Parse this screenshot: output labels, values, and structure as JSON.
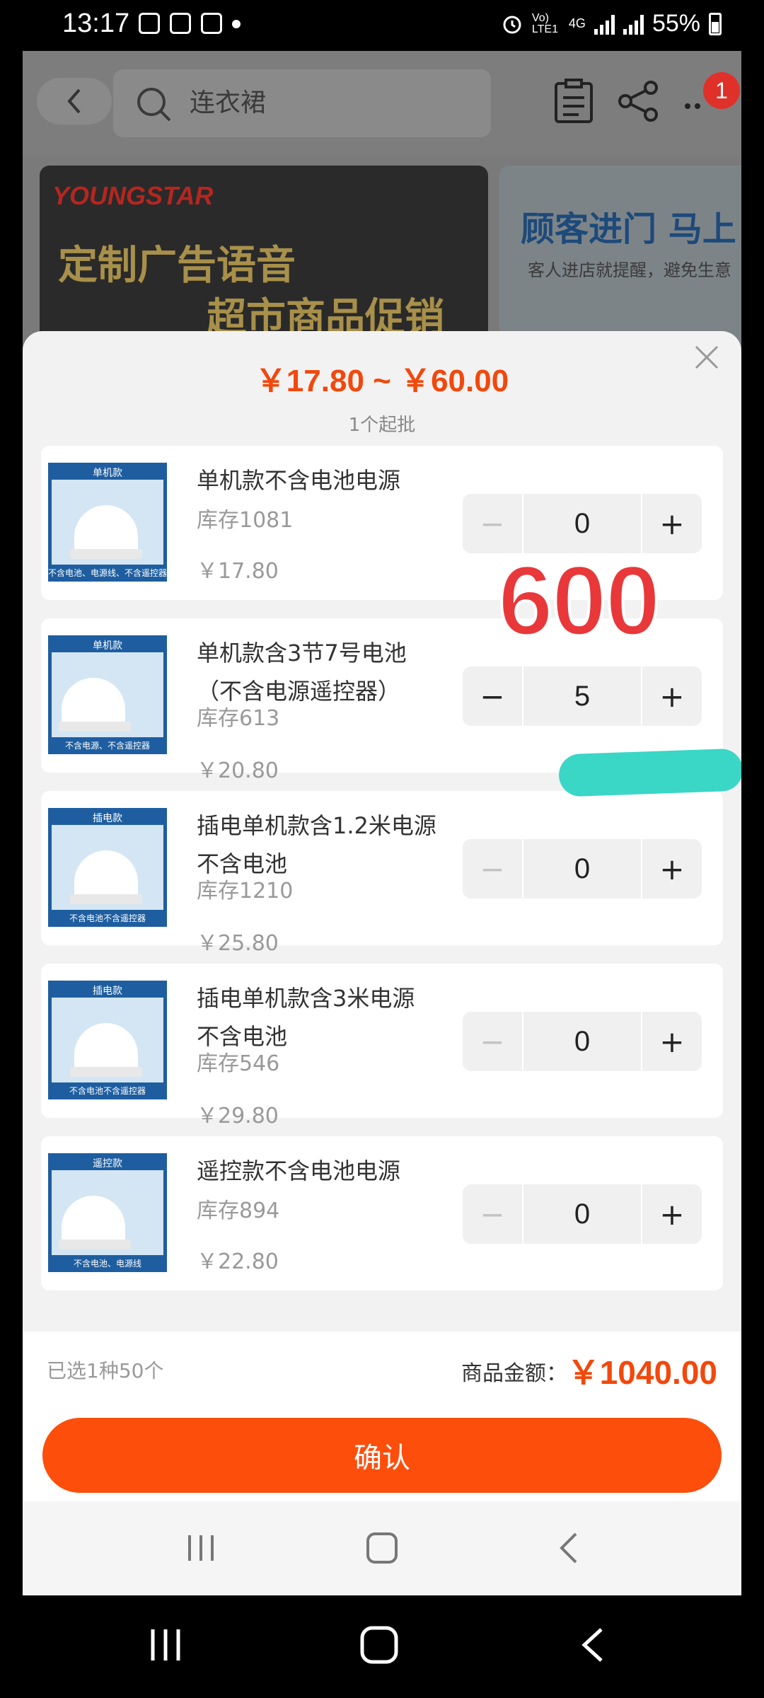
{
  "status_bar": {
    "time": "13:17",
    "battery": "55%",
    "net_label": "4G",
    "volte_label": "Vo) LTE1"
  },
  "header": {
    "search_placeholder": "连衣裙",
    "cart_badge": "1"
  },
  "banners": {
    "left": {
      "logo": "YOUNGSTAR",
      "line1": "定制广告语音",
      "line2": "超市商品促销"
    },
    "right": {
      "title": "顾客进门 马上",
      "subtitle": "客人进店就提醒，避免生意"
    }
  },
  "sheet": {
    "price_range": "￥17.80 ~ ￥60.00",
    "moq": "1个起批",
    "overlay_number": "600",
    "products": [
      {
        "tag": "单机款",
        "caption": "不含电池、电源线、不含遥控器",
        "name": "单机款不含电池电源",
        "stock": "库存1081",
        "price": "￥17.80",
        "qty": "0",
        "minus": "−",
        "plus": "+"
      },
      {
        "tag": "单机款",
        "caption": "不含电源、不含遥控器",
        "name": "单机款含3节7号电池（不含电源遥控器）",
        "stock": "库存613",
        "price": "￥20.80",
        "qty": "5",
        "minus": "−",
        "plus": "+"
      },
      {
        "tag": "插电款",
        "caption": "不含电池不含遥控器",
        "name": "插电单机款含1.2米电源不含电池",
        "stock": "库存1210",
        "price": "￥25.80",
        "qty": "0",
        "minus": "−",
        "plus": "+"
      },
      {
        "tag": "插电款",
        "caption": "不含电池不含遥控器",
        "name": "插电单机款含3米电源不含电池",
        "stock": "库存546",
        "price": "￥29.80",
        "qty": "0",
        "minus": "−",
        "plus": "+"
      },
      {
        "tag": "遥控款",
        "caption": "不含电池、电源线",
        "name": "遥控款不含电池电源",
        "stock": "库存894",
        "price": "￥22.80",
        "qty": "0",
        "minus": "−",
        "plus": "+"
      }
    ]
  },
  "summary": {
    "selected": "已选1种50个",
    "total_label": "商品金额：",
    "total_value": "￥1040.00"
  },
  "confirm_label": "确认",
  "colors": {
    "accent": "#fd4e0c",
    "price": "#f2480c"
  }
}
